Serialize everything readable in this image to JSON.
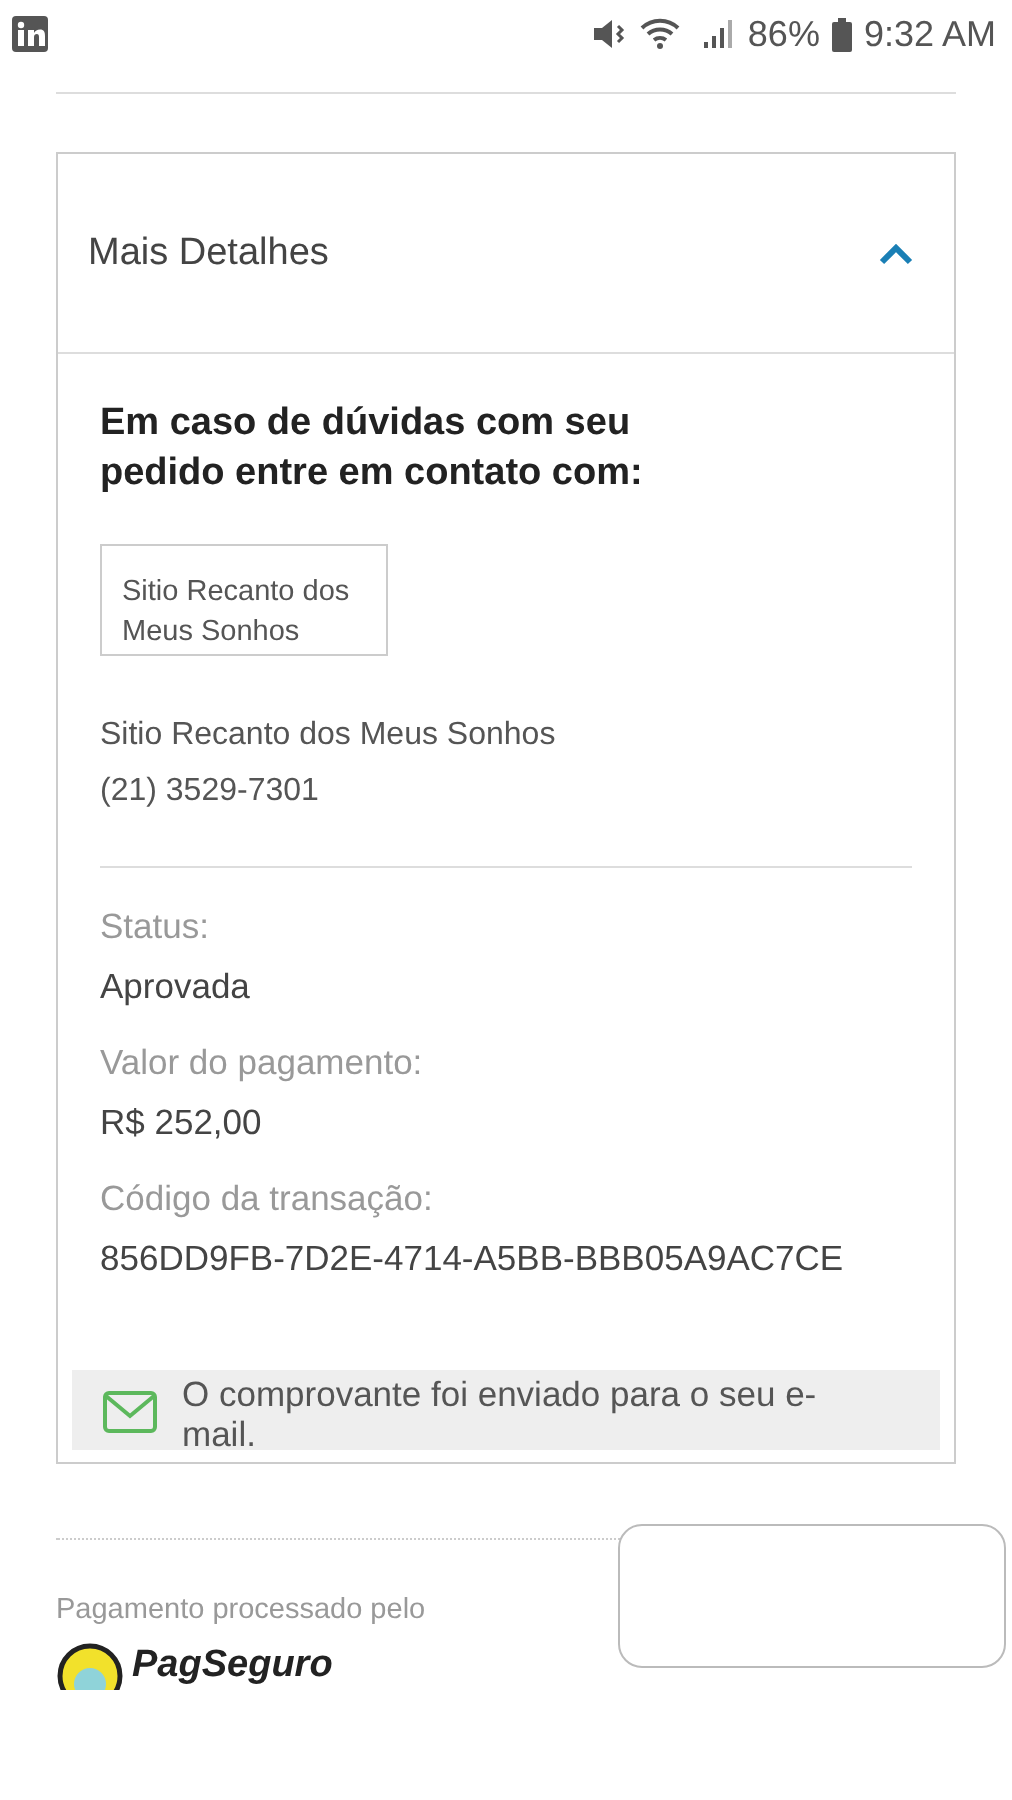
{
  "status_bar": {
    "battery": "86%",
    "time": "9:32 AM"
  },
  "details": {
    "title": "Mais Detalhes",
    "expanded": true,
    "contact_heading": "Em caso de dúvidas com seu pedido entre em contato com:",
    "seller_box": "Sitio Recanto dos Meus Sonhos",
    "seller_name": "Sitio Recanto dos Meus Sonhos",
    "seller_phone": "(21) 3529-7301",
    "fields": [
      {
        "label": "Status:",
        "value": "Aprovada"
      },
      {
        "label": "Valor do pagamento:",
        "value": "R$ 252,00"
      },
      {
        "label": "Código da transação:",
        "value": "856DD9FB-7D2E-4714-A5BB-BBB05A9AC7CE"
      }
    ],
    "notice": "O comprovante foi enviado para o seu e-mail."
  },
  "footer": {
    "processed_by": "Pagamento processado pelo",
    "logo": "PagSeguro"
  }
}
